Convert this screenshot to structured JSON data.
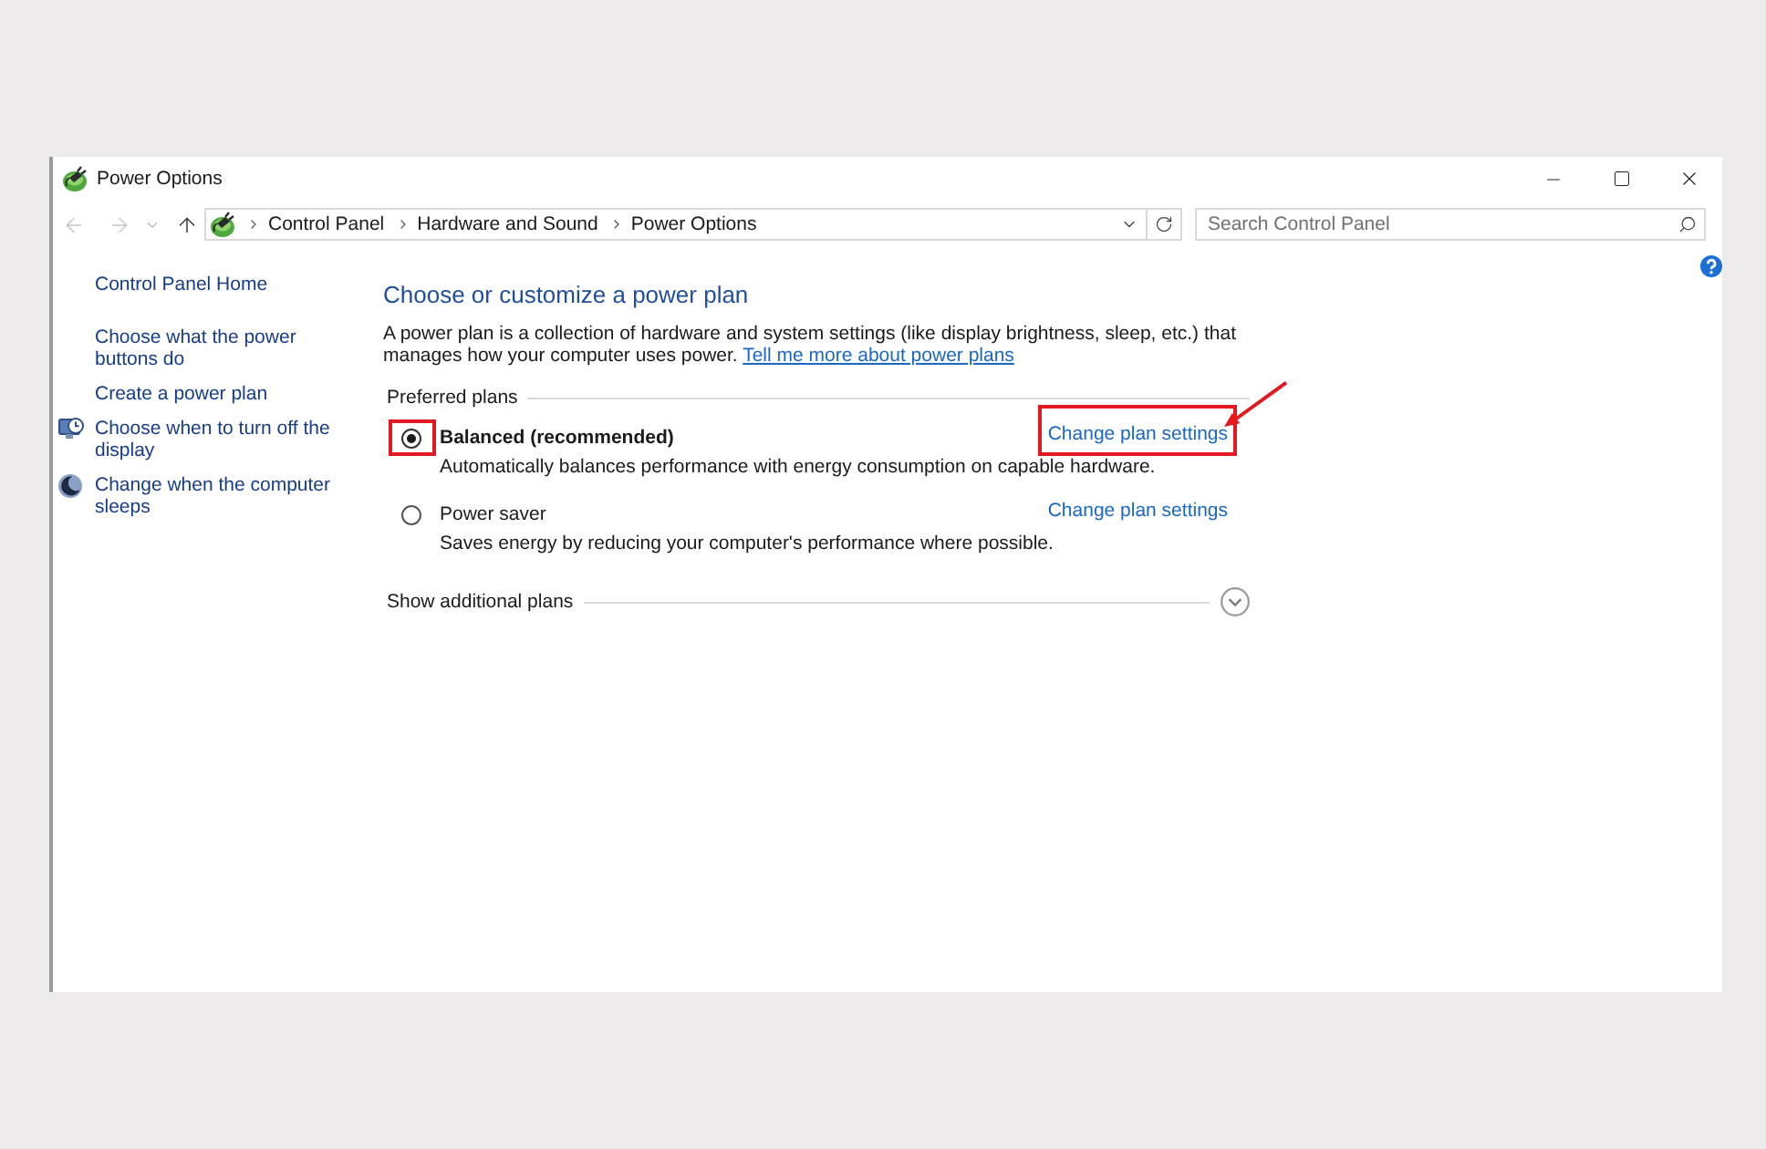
{
  "window": {
    "title": "Power Options"
  },
  "navigation": {
    "back": {
      "disabled": true
    },
    "forward": {
      "disabled": true
    },
    "up": {
      "disabled": false
    }
  },
  "address_bar": {
    "breadcrumbs": [
      "Control Panel",
      "Hardware and Sound",
      "Power Options"
    ]
  },
  "search": {
    "placeholder": "Search Control Panel"
  },
  "sidebar": {
    "home": "Control Panel Home",
    "items": [
      {
        "kind": "link",
        "label": "Choose what the power buttons do"
      },
      {
        "kind": "link",
        "label": "Create a power plan"
      },
      {
        "kind": "display",
        "label": "Choose when to turn off the display"
      },
      {
        "kind": "sleep",
        "label": "Change when the computer sleeps"
      }
    ]
  },
  "content": {
    "title": "Choose or customize a power plan",
    "description": "A power plan is a collection of hardware and system settings (like display brightness, sleep, etc.) that manages how your computer uses power.",
    "description_link": "Tell me more about power plans",
    "section": "Preferred plans",
    "plans": [
      {
        "name": "Balanced (recommended)",
        "description": "Automatically balances performance with energy consumption on capable hardware.",
        "link": "Change plan settings",
        "selected": true,
        "highlighted": true
      },
      {
        "name": "Power saver",
        "description": "Saves energy by reducing your computer's performance where possible.",
        "link": "Change plan settings",
        "selected": false,
        "highlighted": false
      }
    ],
    "more": {
      "label": "Show additional plans",
      "expanded": false
    }
  }
}
